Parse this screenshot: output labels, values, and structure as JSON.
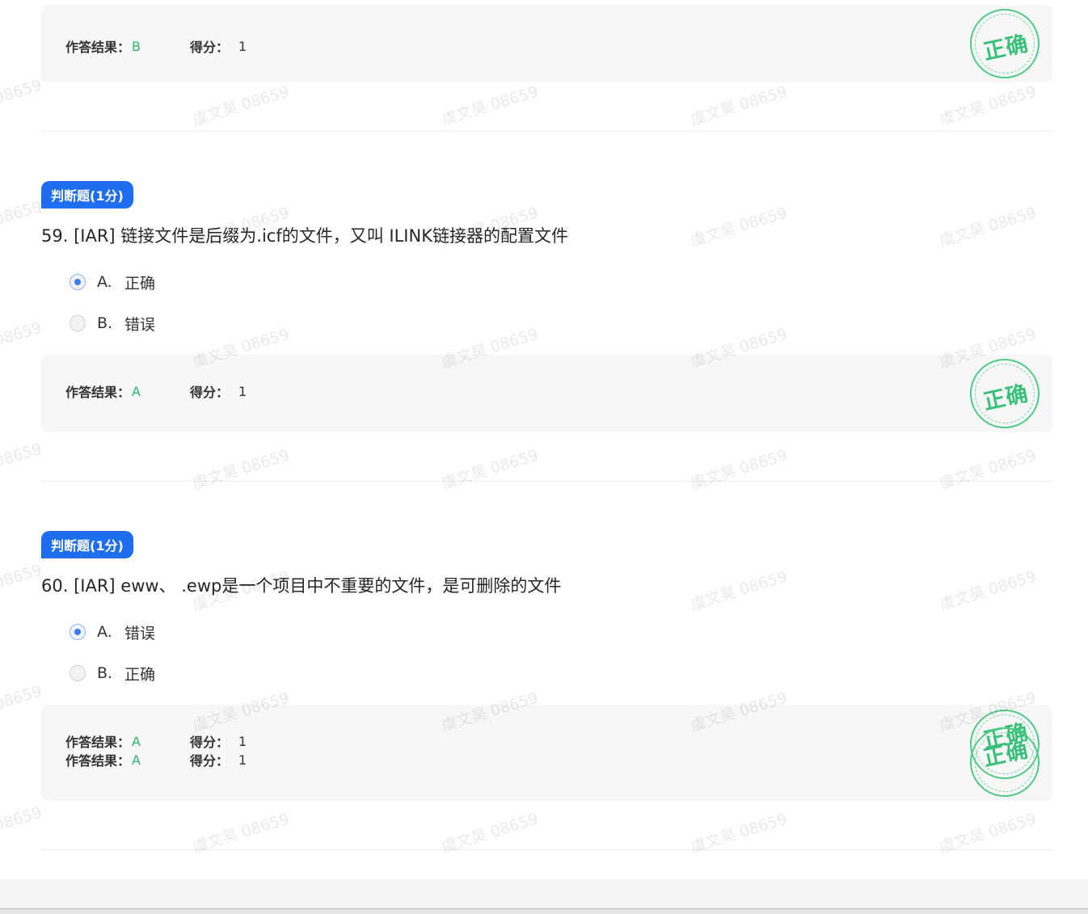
{
  "questions": [
    {
      "answer_label": "作答结果：",
      "answer_value": "B",
      "score_label": "得分：",
      "score_value": "1",
      "stamp": "正确"
    },
    {
      "type_badge": "判断题(1分)",
      "title": "59. [IAR] 链接文件是后缀为.icf的文件，又叫 ILINK链接器的配置文件",
      "options": [
        {
          "letter": "A.",
          "text": "正确",
          "selected": true
        },
        {
          "letter": "B.",
          "text": "错误",
          "selected": false
        }
      ],
      "answer_label": "作答结果：",
      "answer_value": "A",
      "score_label": "得分：",
      "score_value": "1",
      "stamp": "正确"
    },
    {
      "type_badge": "判断题(1分)",
      "title": "60. [IAR] eww、 .ewp是一个项目中不重要的文件，是可删除的文件",
      "options": [
        {
          "letter": "A.",
          "text": "错误",
          "selected": true
        },
        {
          "letter": "B.",
          "text": "正确",
          "selected": false
        }
      ],
      "answer_label": "作答结果：",
      "answer_value": "A",
      "score_label": "得分：",
      "score_value": "1",
      "answer_label_2": "作答结果：",
      "answer_value_2": "A",
      "score_label_2": "得分：",
      "score_value_2": "1",
      "stamp": "正确",
      "stamp_2": "正确"
    }
  ],
  "watermark": "虞文昊 08659",
  "colors": {
    "badge": "#1f6ef0",
    "correct_green": "#2fb56a",
    "stamp_green": "#3ac07a",
    "radio_selected": "#3d7be8"
  }
}
